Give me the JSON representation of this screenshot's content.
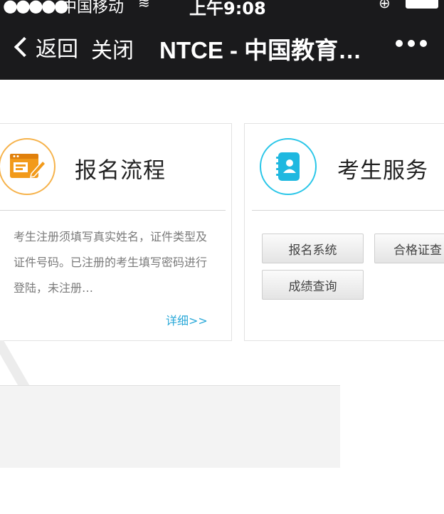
{
  "status_bar": {
    "signal_dots": "●●●●●",
    "carrier": "中国移动",
    "time": "上午9:08"
  },
  "nav": {
    "back_label": "返回",
    "close_label": "关闭",
    "title": "NTCE - 中国教育…"
  },
  "cards": {
    "registration": {
      "title": "报名流程",
      "description": "考生注册须填写真实姓名，证件类型及证件号码。已注册的考生填写密码进行登陆，未注册…",
      "more_link": "详细>>"
    },
    "services": {
      "title": "考生服务",
      "buttons": [
        "报名系统",
        "合格证查",
        "成绩查询"
      ]
    }
  },
  "colors": {
    "nav_bg": "#1a1a1c",
    "registration_accent": "#f6b24a",
    "services_accent": "#29c6e8",
    "link": "#29a8d8"
  }
}
